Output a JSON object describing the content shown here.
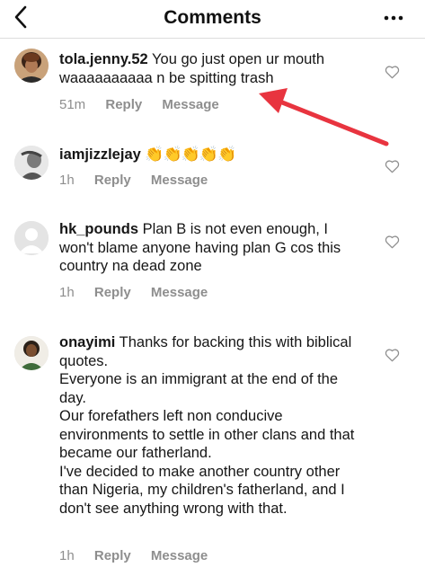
{
  "header": {
    "title": "Comments",
    "back_icon": "chevron-left-icon",
    "more_icon": "ellipsis-icon"
  },
  "comments": [
    {
      "username": "tola.jenny.52",
      "text": "You go just open ur mouth waaaaaaaaaa n be spitting trash",
      "time": "51m",
      "reply": "Reply",
      "message": "Message"
    },
    {
      "username": "iamjizzlejay",
      "emoji": "👏👏👏👏👏",
      "time": "1h",
      "reply": "Reply",
      "message": "Message"
    },
    {
      "username": "hk_pounds",
      "text": "Plan B is not even enough, I won't blame anyone having plan G cos this country na dead zone",
      "time": "1h",
      "reply": "Reply",
      "message": "Message"
    },
    {
      "username": "onayimi",
      "text": "Thanks for backing this with biblical quotes.",
      "paragraphs": [
        "Everyone is an immigrant at the end of the day.",
        "Our forefathers left non conducive environments to settle in other clans and that became our fatherland.",
        "I've decided to make another country other than Nigeria, my children's fatherland, and I don't see anything wrong with that."
      ],
      "time": "1h",
      "reply": "Reply",
      "message": "Message"
    }
  ],
  "annotation": {
    "arrow_color": "#e8343f"
  }
}
